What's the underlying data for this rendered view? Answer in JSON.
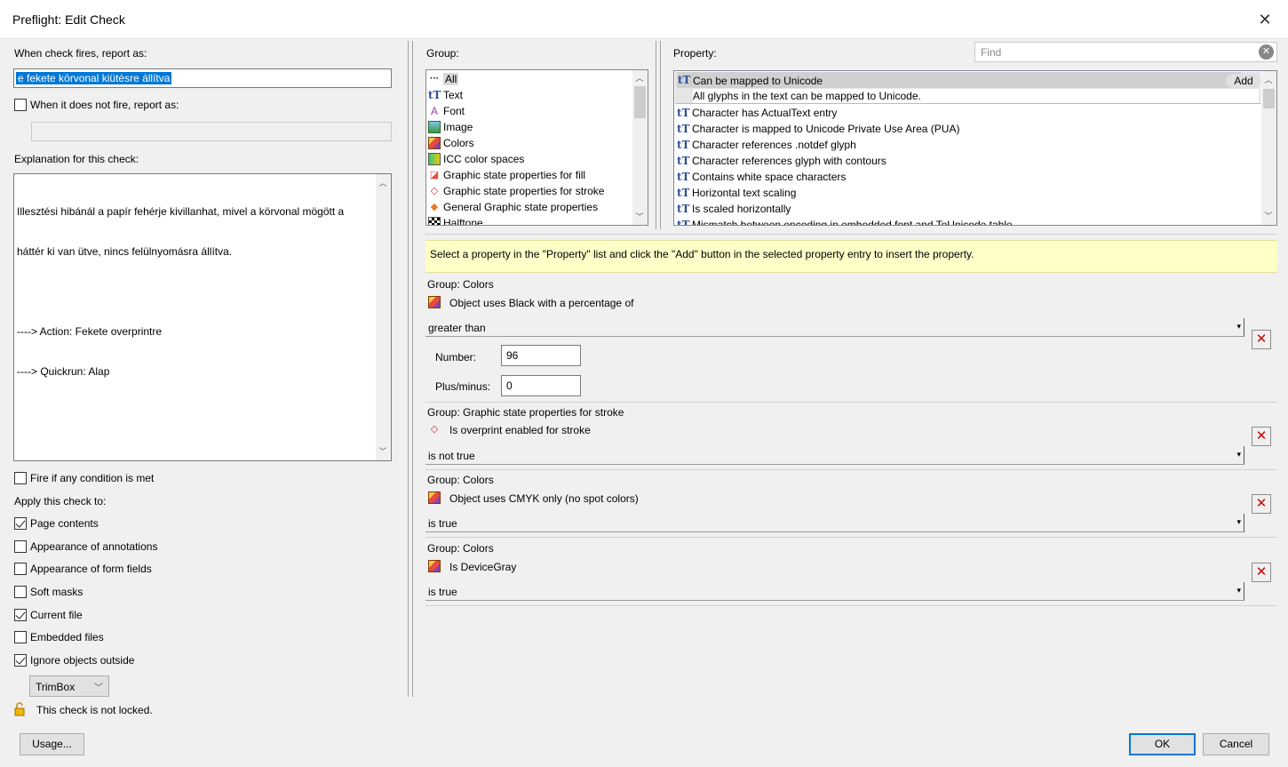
{
  "window": {
    "title": "Preflight: Edit Check",
    "close_glyph": "✕"
  },
  "left": {
    "report_label": "When check fires, report as:",
    "report_value": "e fekete körvonal kiütésre állítva",
    "not_fire_label": "When it does not fire, report as:",
    "not_fire_value": "",
    "explanation_label": "Explanation for this check:",
    "explanation_lines": [
      "Illesztési hibánál a papír fehérje kivillanhat, mivel a körvonal mögött a",
      "háttér ki van ütve, nincs felülnyomásra állítva.",
      "",
      "----> Action: Fekete overprintre",
      "----> Quickrun: Alap"
    ],
    "fire_any_label": "Fire if any condition is met",
    "apply_label": "Apply this check to:",
    "options": [
      {
        "label": "Page contents",
        "checked": true
      },
      {
        "label": "Appearance of annotations",
        "checked": false
      },
      {
        "label": "Appearance of form fields",
        "checked": false
      },
      {
        "label": "Soft masks",
        "checked": false
      },
      {
        "label": "Current file",
        "checked": true
      },
      {
        "label": "Embedded files",
        "checked": false
      },
      {
        "label": "Ignore objects outside",
        "checked": true
      }
    ],
    "box_select": "TrimBox",
    "lock_text": "This check is not locked."
  },
  "group": {
    "label": "Group:",
    "items": [
      {
        "label": "All",
        "icon": "ellipsis-icon",
        "selected": true
      },
      {
        "label": "Text",
        "icon": "text-icon"
      },
      {
        "label": "Font",
        "icon": "font-icon"
      },
      {
        "label": "Image",
        "icon": "image-icon"
      },
      {
        "label": "Colors",
        "icon": "colors-icon"
      },
      {
        "label": "ICC color spaces",
        "icon": "icc-icon"
      },
      {
        "label": "Graphic state properties for fill",
        "icon": "fill-state-icon"
      },
      {
        "label": "Graphic state properties for stroke",
        "icon": "stroke-state-icon"
      },
      {
        "label": "General Graphic state properties",
        "icon": "general-state-icon"
      },
      {
        "label": "Halftone",
        "icon": "halftone-icon"
      }
    ]
  },
  "property": {
    "label": "Property:",
    "find_placeholder": "Find",
    "selected_title": "Can be mapped to Unicode",
    "selected_desc": "All glyphs in the text can be mapped to Unicode.",
    "add_label": "Add",
    "items": [
      "Character has ActualText entry",
      "Character is mapped to Unicode Private Use Area (PUA)",
      "Character references .notdef glyph",
      "Character references glyph with contours",
      "Contains white space characters",
      "Horizontal text scaling",
      "Is scaled horizontally",
      "Mismatch between encoding in embedded font and ToUnicode table"
    ]
  },
  "hint": "Select a property in the \"Property\" list and click the \"Add\" button in the selected property entry to insert the property.",
  "conditions": [
    {
      "group": "Group: Colors",
      "title": "Object uses Black with a percentage of",
      "operator": "greater than",
      "number_label": "Number:",
      "number": "96",
      "plusminus_label": "Plus/minus:",
      "plusminus": "0"
    },
    {
      "group": "Group: Graphic state properties for stroke",
      "title": "Is overprint enabled for stroke",
      "operator": "is not true"
    },
    {
      "group": "Group: Colors",
      "title": "Object uses CMYK only (no spot colors)",
      "operator": "is true"
    },
    {
      "group": "Group: Colors",
      "title": "Is DeviceGray",
      "operator": "is true"
    }
  ],
  "buttons": {
    "usage": "Usage...",
    "ok": "OK",
    "cancel": "Cancel"
  }
}
